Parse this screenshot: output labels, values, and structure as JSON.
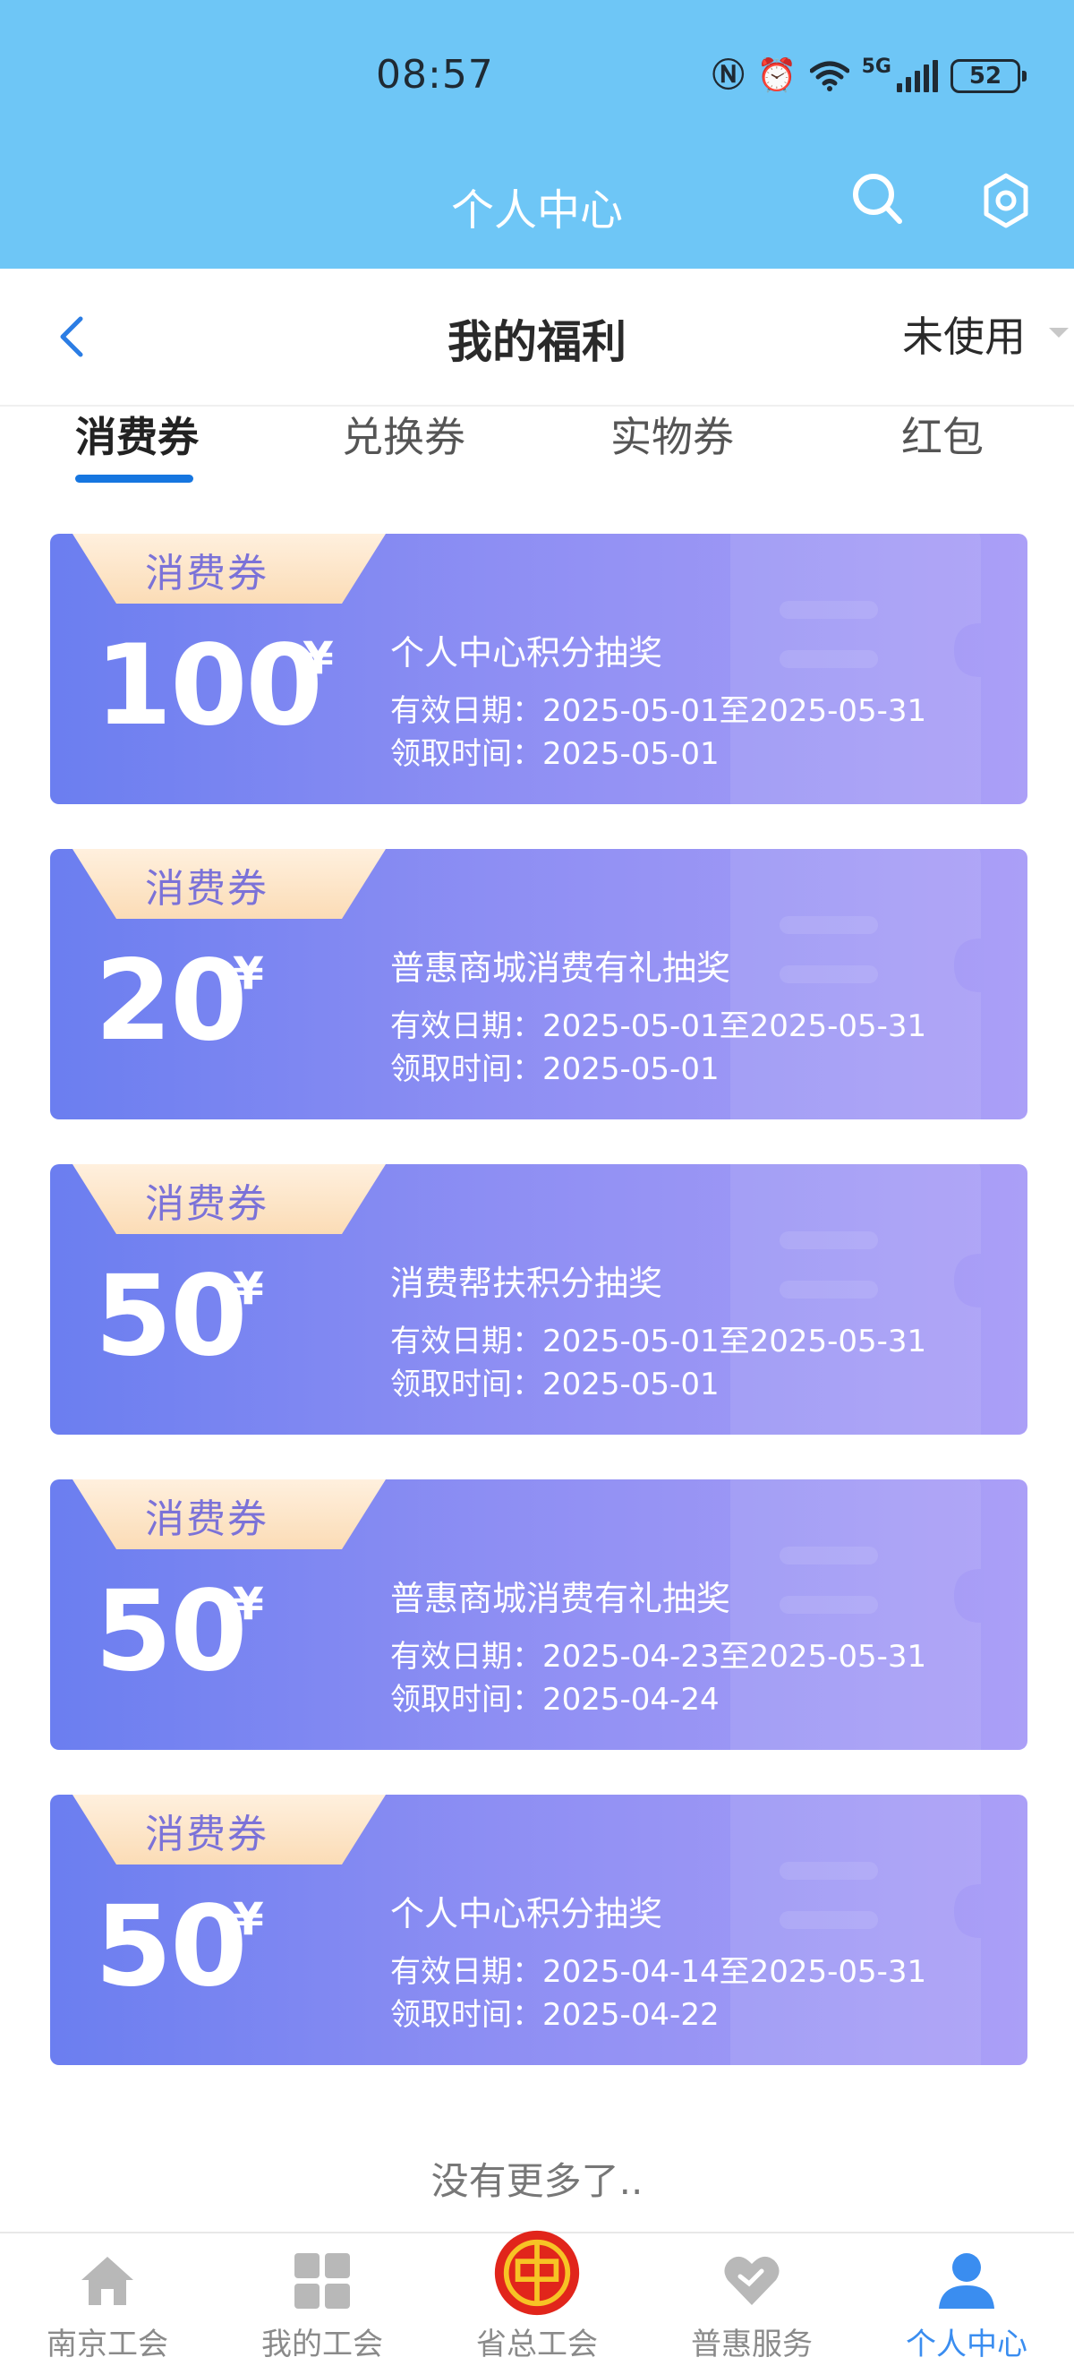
{
  "status_bar": {
    "time": "08:57",
    "battery": "52",
    "network": "5G"
  },
  "header": {
    "title": "个人中心"
  },
  "subheader": {
    "title": "我的福利",
    "filter": "未使用"
  },
  "tabs": [
    {
      "label": "消费券",
      "active": true
    },
    {
      "label": "兑换券",
      "active": false
    },
    {
      "label": "实物券",
      "active": false
    },
    {
      "label": "红包",
      "active": false
    }
  ],
  "coupons": [
    {
      "tag": "消费券",
      "amount": "100",
      "currency": "¥",
      "name": "个人中心积分抽奖",
      "valid": "有效日期：2025-05-01至2025-05-31",
      "received": "领取时间：2025-05-01"
    },
    {
      "tag": "消费券",
      "amount": "20",
      "currency": "¥",
      "name": "普惠商城消费有礼抽奖",
      "valid": "有效日期：2025-05-01至2025-05-31",
      "received": "领取时间：2025-05-01"
    },
    {
      "tag": "消费券",
      "amount": "50",
      "currency": "¥",
      "name": "消费帮扶积分抽奖",
      "valid": "有效日期：2025-05-01至2025-05-31",
      "received": "领取时间：2025-05-01"
    },
    {
      "tag": "消费券",
      "amount": "50",
      "currency": "¥",
      "name": "普惠商城消费有礼抽奖",
      "valid": "有效日期：2025-04-23至2025-05-31",
      "received": "领取时间：2025-04-24"
    },
    {
      "tag": "消费券",
      "amount": "50",
      "currency": "¥",
      "name": "个人中心积分抽奖",
      "valid": "有效日期：2025-04-14至2025-05-31",
      "received": "领取时间：2025-04-22"
    }
  ],
  "footer_text": "没有更多了..",
  "bottom_nav": [
    {
      "label": "南京工会",
      "icon": "home-icon",
      "active": false
    },
    {
      "label": "我的工会",
      "icon": "grid-icon",
      "active": false
    },
    {
      "label": "省总工会",
      "icon": "union-emblem-icon",
      "active": false
    },
    {
      "label": "普惠服务",
      "icon": "heart-icon",
      "active": false
    },
    {
      "label": "个人中心",
      "icon": "person-icon",
      "active": true
    }
  ],
  "colors": {
    "header_bg": "#6ec6f6",
    "accent": "#1676e0",
    "coupon_start": "#6b7ef0",
    "coupon_end": "#ab9ff7",
    "nav_active": "#3a8df0"
  }
}
